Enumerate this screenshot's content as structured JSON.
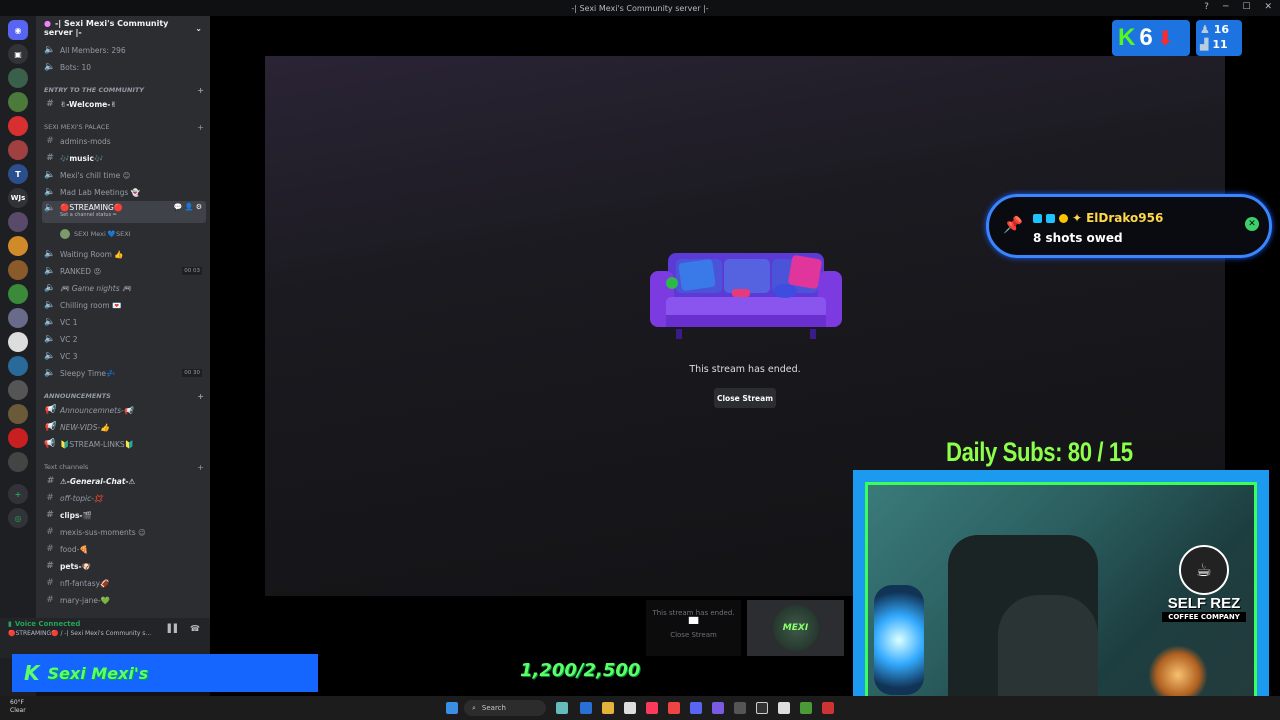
{
  "window": {
    "title": "-| Sexi Mexi's Community server |-"
  },
  "server": {
    "name": "-| Sexi Mexi's Community server |-"
  },
  "stats": {
    "members": "All Members: 296",
    "bots": "Bots: 10"
  },
  "categories": {
    "entry": "ENTRY TO THE COMMUNITY",
    "palace": "SEXI MEXI's PALACE",
    "announcements": "ANNOUNCEMENTS",
    "text": "Text channels"
  },
  "channels": {
    "welcome": "✌-Welcome-✌",
    "admins": "admins-mods",
    "music": "🎶music🎶",
    "chill": "Mexi's chill time 😊",
    "madlab": "Mad Lab Meetings 👻",
    "streaming": "🔴STREAMING🔴",
    "streaming_status": "Set a channel status ✏",
    "voice_user": "SEXI Mexi 💙SEXI",
    "waiting": "Waiting Room 👍",
    "ranked": "RANKED 😡",
    "ranked_count": "00 03",
    "gamenights": "🎮 Game nights 🎮",
    "chilling": "Chilling room 💌",
    "vc1": "VC 1",
    "vc2": "VC 2",
    "vc3": "VC 3",
    "sleepy": "Sleepy Time💤",
    "sleepy_count": "00 30",
    "announcements": "Announcemnets-📢",
    "newvids": "NEW-VIDS-👍",
    "streamlinks": "🔰STREAM-LINKS🔰",
    "general": "⚠-General-Chat-⚠",
    "offtopic": "off-topic-💢",
    "clips": "clips-🎬",
    "sus": "mexis-sus-moments 😉",
    "food": "food-🍕",
    "pets": "pets-🐶",
    "nfl": "nfl-fantasy🏈",
    "mary": "mary-jane-💚"
  },
  "voice": {
    "status": "Voice Connected",
    "channel": "🔴STREAMING🔴 / -| Sexi Mexi's Community s..."
  },
  "stream": {
    "ended": "This stream has ended.",
    "close": "Close Stream"
  },
  "tile": {
    "ended": "This stream has ended.",
    "close": "Close Stream",
    "logo": "MEXI"
  },
  "overlay": {
    "kick_letter": "K",
    "kick_name": "Sexi Mexi's",
    "goal": "1,200/2,500",
    "daily_subs": "Daily Subs:  80 / 15",
    "kick_count": "6",
    "viewers_a": "16",
    "viewers_b": "11",
    "notif_user": "ElDrako956",
    "notif_text": "8 shots owed",
    "selfrez_title": "SELF REZ",
    "selfrez_sub": "COFFEE COMPANY"
  },
  "taskbar": {
    "search": "Search",
    "weather_temp": "60°F",
    "weather_desc": "Clear"
  },
  "colors": {
    "accent": "#5865f2",
    "kick_green": "#5cff6a",
    "cam_border": "#1c9af0",
    "live_red": "#f23f43"
  }
}
